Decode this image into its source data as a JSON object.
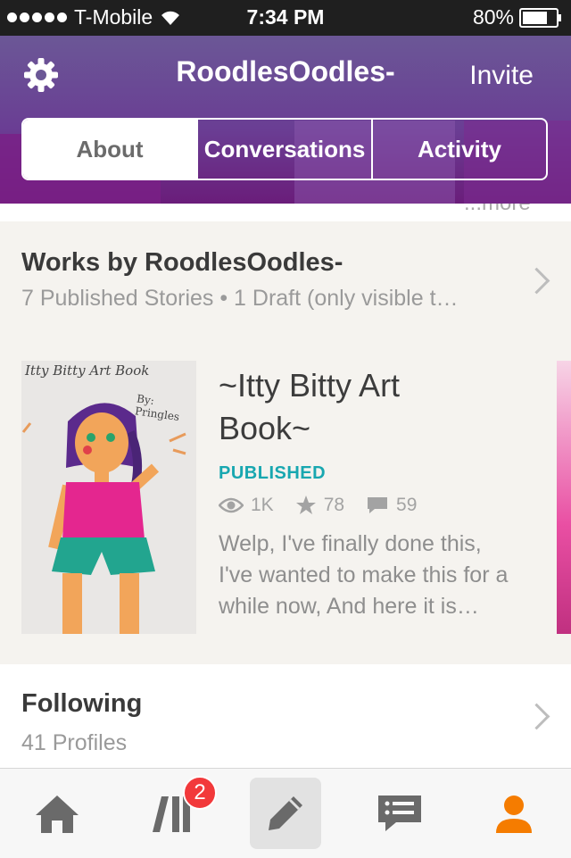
{
  "status_bar": {
    "carrier": "T-Mobile",
    "time": "7:34 PM",
    "battery": "80%",
    "battery_level": 0.8
  },
  "header": {
    "username": "RoodlesOodles-",
    "invite_label": "Invite",
    "tabs": [
      {
        "label": "About",
        "active": true
      },
      {
        "label": "Conversations",
        "active": false
      },
      {
        "label": "Activity",
        "active": false
      }
    ]
  },
  "peek_text": "...more",
  "works": {
    "title": "Works by RoodlesOodles-",
    "subtitle": "7 Published Stories • 1 Draft (only visible t…",
    "cover_title": "Itty Bitty Art Book",
    "cover_by": "By: Pringles",
    "story": {
      "title": "~Itty Bitty Art Book~",
      "status": "PUBLISHED",
      "reads": "1K",
      "votes": "78",
      "comments": "59",
      "blurb": "Welp, I've finally done this, I've wanted to make this for a while now, And here it is…"
    }
  },
  "following": {
    "title": "Following",
    "subtitle": "41 Profiles"
  },
  "tabbar": {
    "items": [
      "home-icon",
      "library-icon",
      "write-icon",
      "messages-icon",
      "profile-icon"
    ],
    "library_badge": "2",
    "active_color": "#f57c00"
  },
  "colors": {
    "accent": "#6a3e94",
    "published": "#18a7b0",
    "badge": "#f2393b"
  }
}
